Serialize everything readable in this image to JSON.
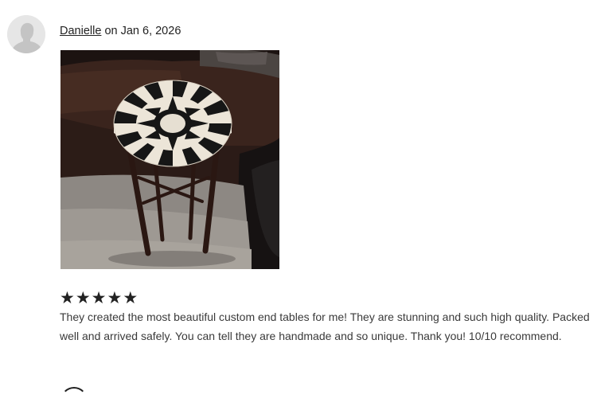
{
  "review": {
    "reviewer_name": "Danielle",
    "date_text": "on Jan 6, 2026",
    "rating": 5,
    "star_glyph": "★",
    "text": "They created the most beautiful custom end tables for me! They are stunning and such high quality. Packed well and arrived safely. You can tell they are handmade and so unique. Thank you! 10/10 recommend.",
    "photo_icon": "end-table-photo",
    "avatar_icon": "default-user-avatar-icon"
  }
}
